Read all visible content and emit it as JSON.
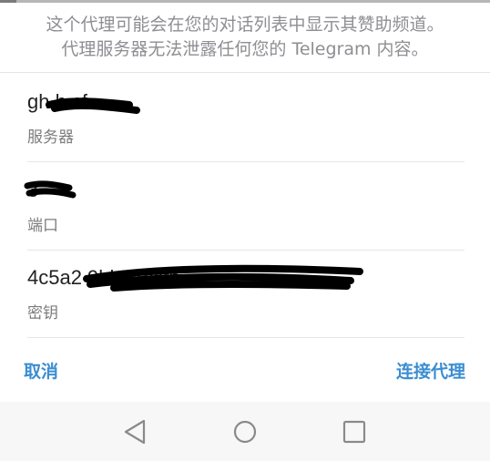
{
  "notice": {
    "line1": "这个代理可能会在您的对话列表中显示其赞助频道。",
    "line2": "代理服务器无法泄露任何您的 Telegram 内容。"
  },
  "fields": [
    {
      "value": "gh          h.cf",
      "label": "服务器"
    },
    {
      "value": "3    ",
      "label": "端口"
    },
    {
      "value": "4c5a2                          9bb57ccfb",
      "label": "密钥"
    }
  ],
  "actions": {
    "cancel": "取消",
    "connect": "连接代理"
  },
  "colors": {
    "accent": "#3b8dd1",
    "label": "#7c7c7c",
    "notice": "#8e8e93"
  },
  "navbar": {
    "icons": [
      "back-triangle-icon",
      "home-circle-icon",
      "recents-square-icon"
    ]
  }
}
